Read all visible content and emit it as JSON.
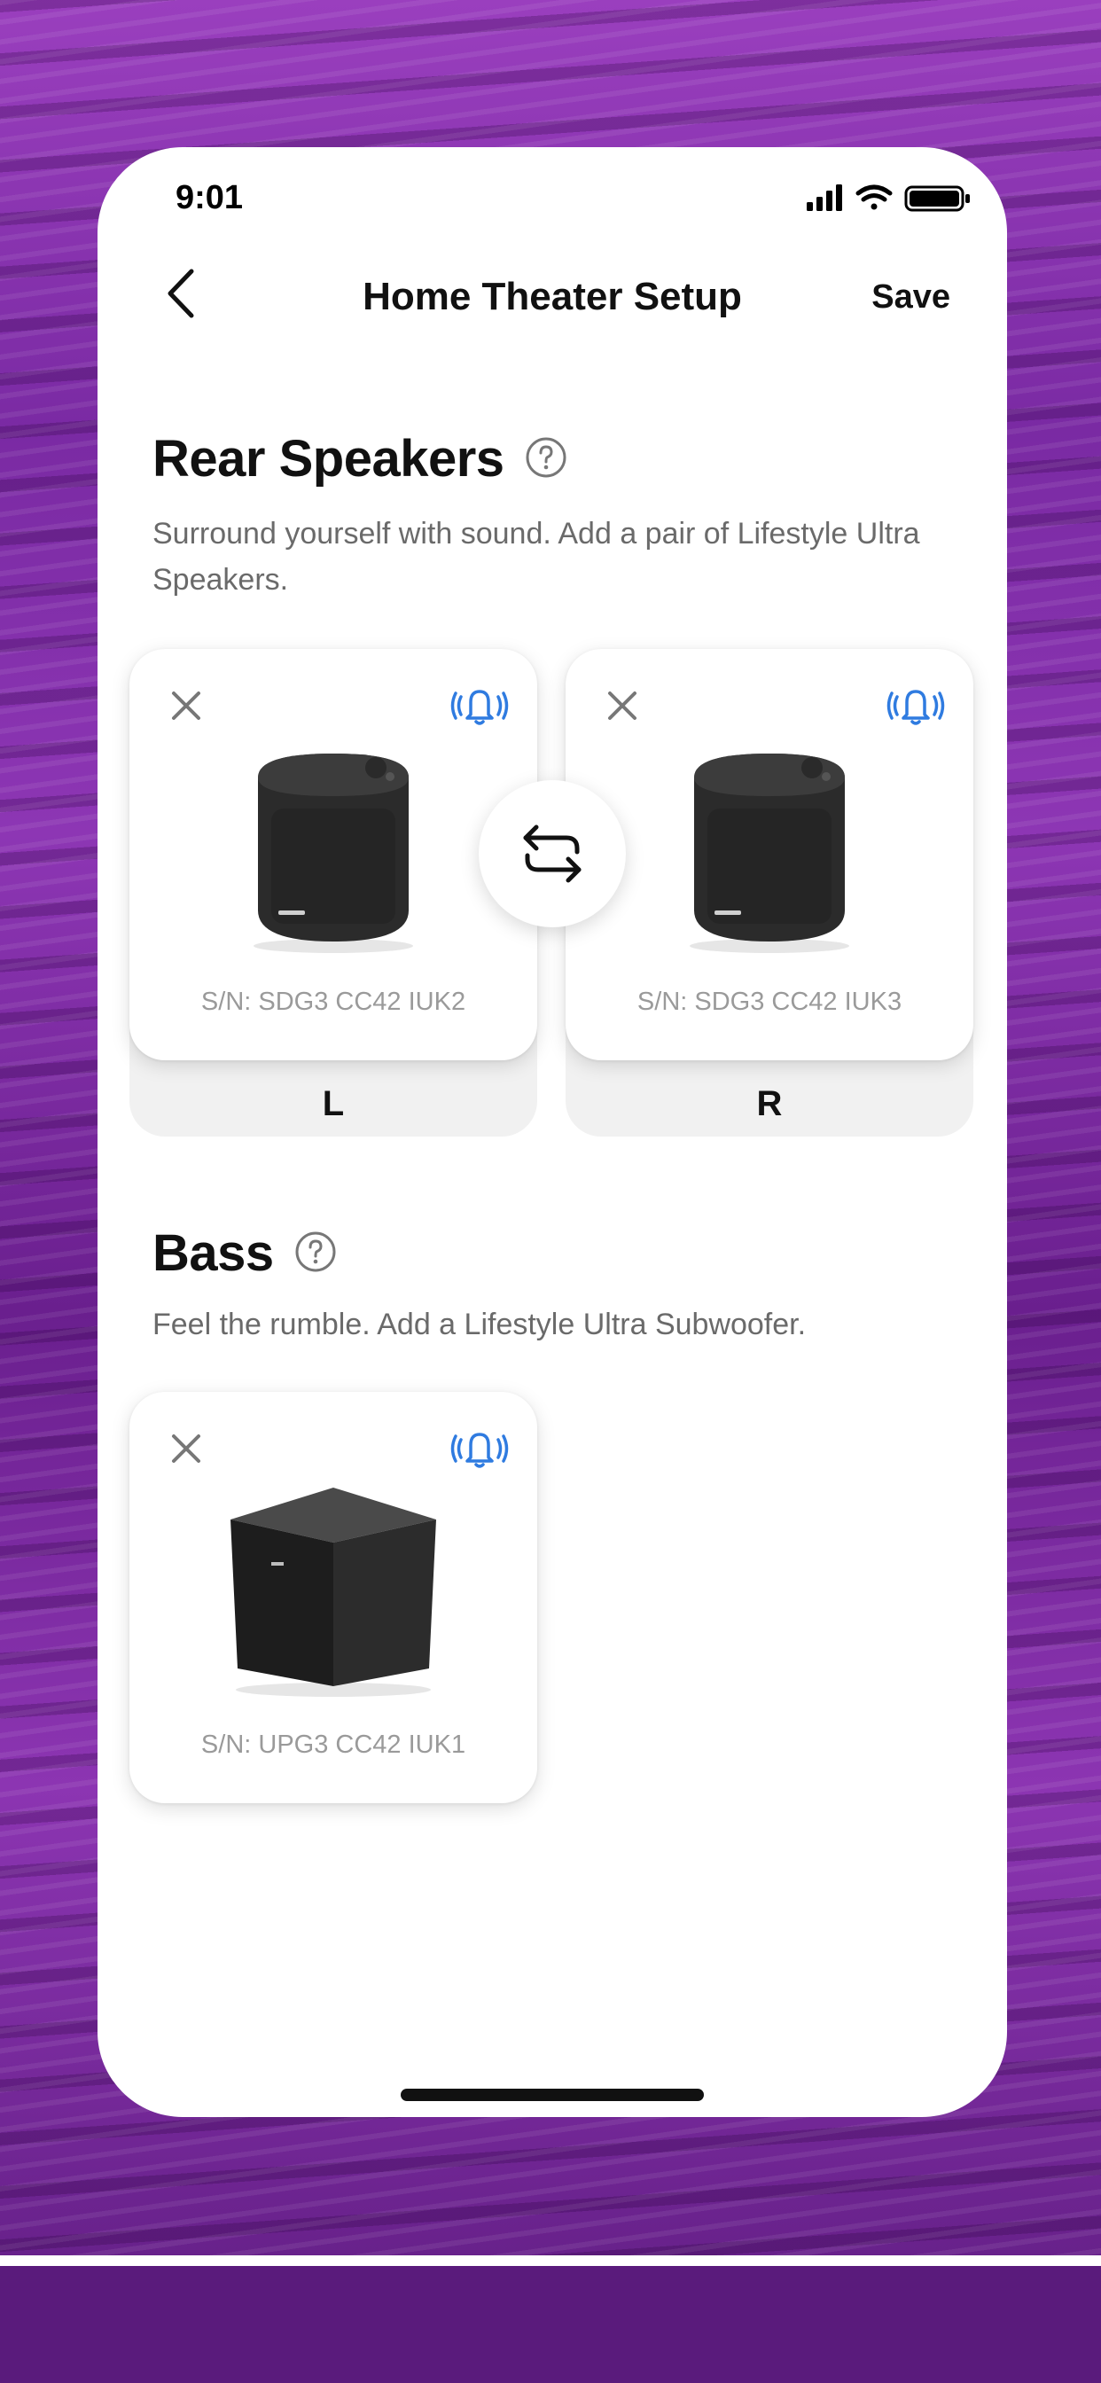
{
  "status_bar": {
    "time": "9:01"
  },
  "nav": {
    "title": "Home Theater Setup",
    "save_label": "Save"
  },
  "rear_speakers": {
    "title": "Rear Speakers",
    "description": "Surround yourself with sound. Add a pair of Lifestyle Ultra Speakers.",
    "left": {
      "serial": "S/N: SDG3 CC42 IUK2",
      "position_label": "L"
    },
    "right": {
      "serial": "S/N: SDG3 CC42 IUK3",
      "position_label": "R"
    }
  },
  "bass": {
    "title": "Bass",
    "description": "Feel the rumble. Add a Lifestyle Ultra Subwoofer.",
    "subwoofer": {
      "serial": "S/N: UPG3 CC42 IUK1"
    }
  },
  "colors": {
    "accent_blue": "#2f7be0",
    "background_purple": "#7a2aa3"
  },
  "icons": [
    "back-chevron-icon",
    "help-icon",
    "close-icon",
    "bell-ringing-icon",
    "swap-icon",
    "signal-icon",
    "wifi-icon",
    "battery-icon"
  ]
}
